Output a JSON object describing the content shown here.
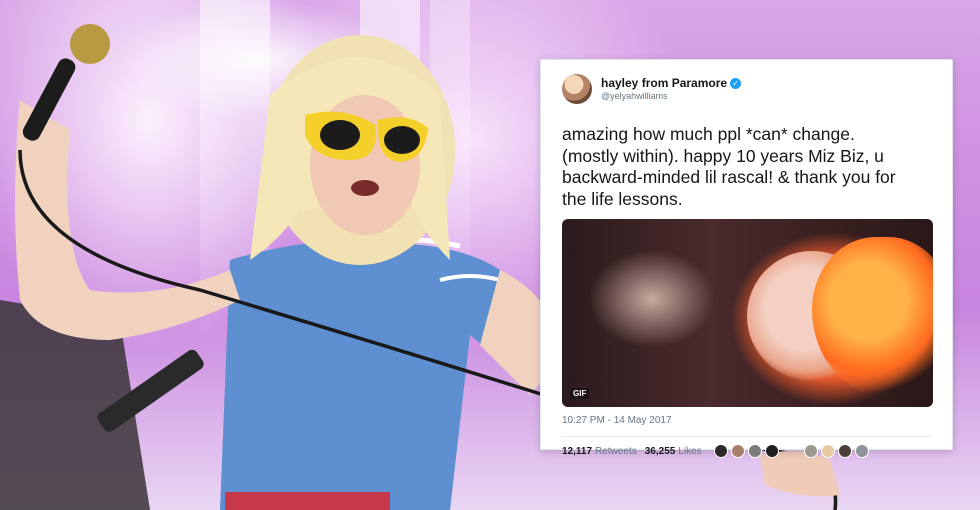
{
  "tweet": {
    "display_name": "hayley from Paramore",
    "verified_icon": "verified-check-icon",
    "handle": "@yelyahwilliams",
    "text": "amazing how much ppl *can* change.\n(mostly within). happy 10 years Miz Biz, u\nbackward-minded lil rascal! & thank you for\nthe life lessons.",
    "media_badge": "GIF",
    "timestamp": "10:27 PM - 14 May 2017",
    "retweets_count": "12,117",
    "retweets_label": "Retweets",
    "likes_count": "36,255",
    "likes_label": "Likes",
    "likers": [
      {
        "color": "#2c2a2a"
      },
      {
        "color": "#a77f6b"
      },
      {
        "color": "#7b7b7b"
      },
      {
        "color": "#1f1f1f"
      },
      {
        "color": "#9a9a8f"
      },
      {
        "color": "#e6c9a0"
      },
      {
        "color": "#4b3f39"
      },
      {
        "color": "#8e939a"
      }
    ]
  },
  "colors": {
    "accent_blue": "#1da1f2",
    "text_dark": "#14171a",
    "text_muted": "#657786"
  }
}
